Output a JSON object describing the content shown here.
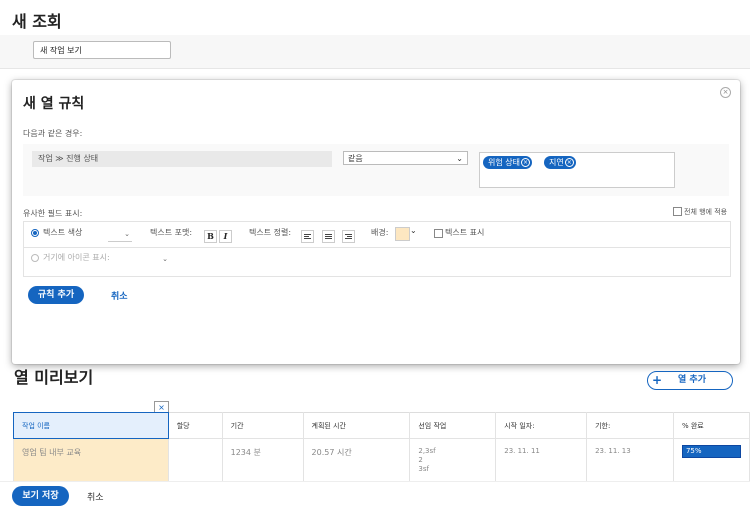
{
  "page": {
    "title": "새 조회",
    "view_name": "새 작업 보기"
  },
  "modal": {
    "title": "새 열 규칙",
    "condition_label": "다음과 같은 경우:",
    "field": "작업 ≫ 진행 상태",
    "operator": "같음",
    "values": [
      "위험 상태",
      "지연"
    ],
    "format_label": "유사한 필드 표시:",
    "apply_all_label": "전체 행에 적용",
    "text_color_label": "텍스트 색상",
    "text_format_label": "텍스트 포맷:",
    "bold_label": "B",
    "italic_label": "I",
    "text_align_label": "텍스트 정렬:",
    "background_label": "배경:",
    "background_color": "#fde7c1",
    "show_text_label": "텍스트 표시",
    "icon_label": "거기에 아이콘 표시:",
    "add_rule_label": "규칙 추가",
    "cancel_label": "취소"
  },
  "preview": {
    "title": "열 미리보기",
    "add_column_label": "열 추가",
    "remove_symbol": "×",
    "columns": [
      "작업 이름",
      "할당",
      "기간",
      "계획된 시간",
      "선임 작업",
      "시작 일자:",
      "기한:",
      "% 완료"
    ],
    "row": {
      "name": "영업 팀 내부 교육",
      "assign": "",
      "duration": "1234 분",
      "planned_hours": "20.57 시간",
      "predecessors": [
        "2,3sf",
        "2",
        "3sf"
      ],
      "start": "23. 11. 11",
      "due": "23. 11. 13",
      "percent": "75%"
    }
  },
  "footer": {
    "save_label": "보기 저장",
    "cancel_label": "취소"
  },
  "colors": {
    "accent": "#1565c0",
    "highlight": "#fdebc8"
  }
}
